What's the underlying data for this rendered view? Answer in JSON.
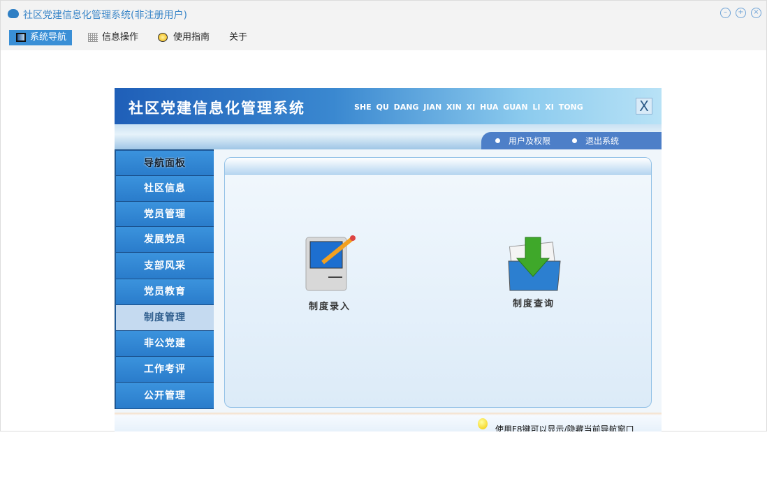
{
  "window": {
    "title": "社区党建信息化管理系统(非注册用户)",
    "controls": [
      "minimize",
      "maximize",
      "close"
    ]
  },
  "menu": [
    {
      "label": "系统导航",
      "icon": "monitor-icon",
      "active": true
    },
    {
      "label": "信息操作",
      "icon": "grid-icon"
    },
    {
      "label": "使用指南",
      "icon": "help-icon"
    },
    {
      "label": "关于"
    }
  ],
  "app": {
    "title": "社区党建信息化管理系统",
    "pinyin": "SHE QU DANG JIAN XIN XI HUA GUAN LI XI TONG",
    "close": "X",
    "links": [
      "用户及权限",
      "退出系统"
    ],
    "sidebar": [
      "导航面板",
      "社区信息",
      "党员管理",
      "发展党员",
      "支部风采",
      "党员教育",
      "制度管理",
      "非公党建",
      "工作考评",
      "公开管理"
    ],
    "selected": "制度管理",
    "features": [
      {
        "label": "制度录入",
        "icon": "computer-pencil-icon"
      },
      {
        "label": "制度查询",
        "icon": "folder-download-icon"
      }
    ],
    "footer": "使用F8键可以显示/隐藏当前导航窗口"
  }
}
